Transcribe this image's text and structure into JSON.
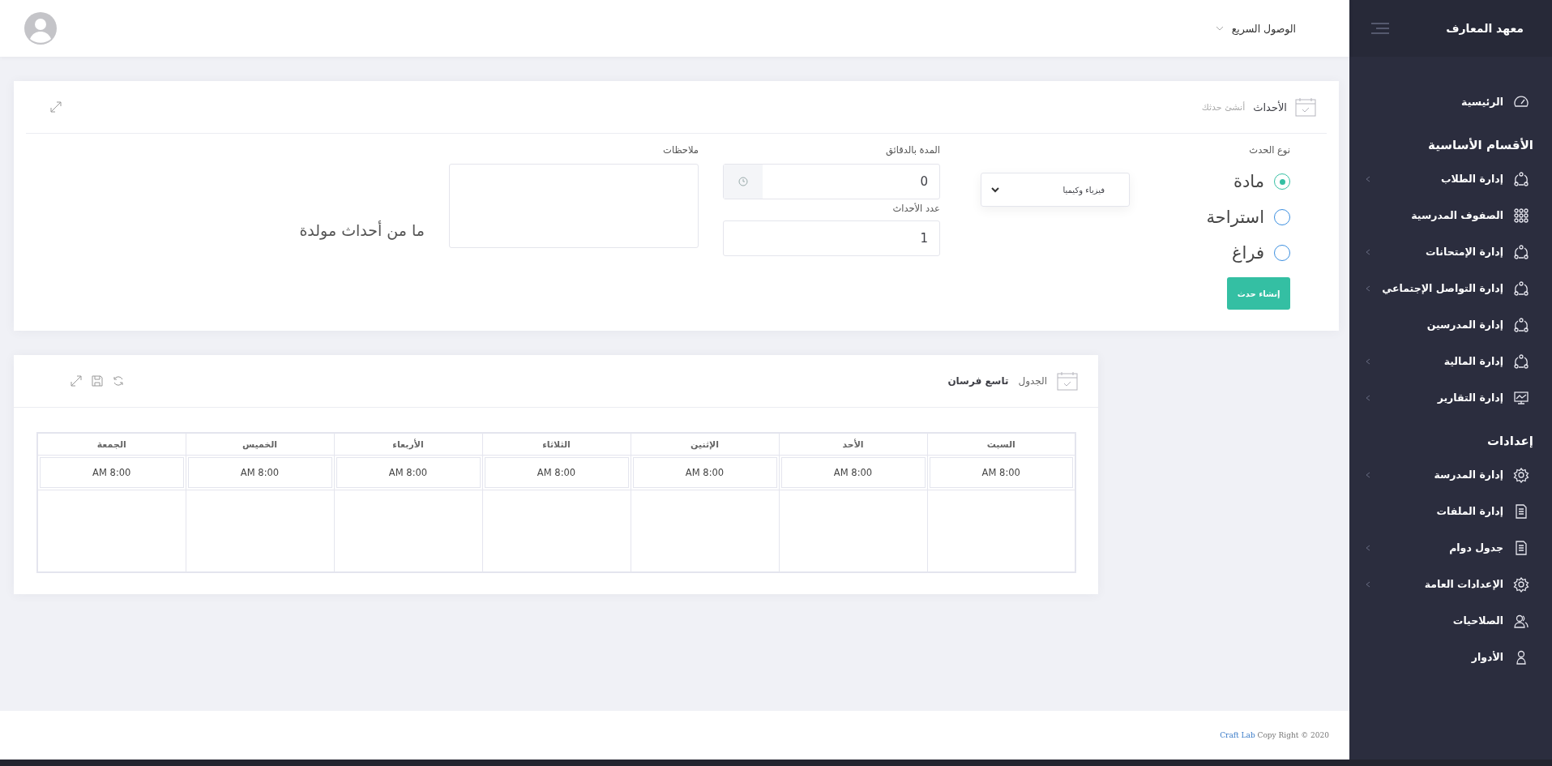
{
  "header": {
    "quick_access": "الوصول السريع"
  },
  "sidebar": {
    "title": "معهد المعارف",
    "groups": [
      {
        "items": [
          {
            "label": "الرئيسية",
            "kind": "gauge",
            "has_submenu": false
          }
        ]
      },
      {
        "heading": "الأقسام الأساسية",
        "items": [
          {
            "label": "إدارة الطلاب",
            "kind": "nodes",
            "has_submenu": true
          },
          {
            "label": "الصفوف المدرسية",
            "kind": "grid",
            "has_submenu": false
          },
          {
            "label": "إدارة الإمتحانات",
            "kind": "nodes",
            "has_submenu": true
          },
          {
            "label": "إدارة التواصل الإجتماعي",
            "kind": "nodes",
            "has_submenu": true
          },
          {
            "label": "إدارة المدرسين",
            "kind": "nodes",
            "has_submenu": false
          },
          {
            "label": "إدارة المالية",
            "kind": "nodes",
            "has_submenu": true
          },
          {
            "label": "إدارة التقارير",
            "kind": "monitor",
            "has_submenu": true
          }
        ]
      },
      {
        "heading": "إعدادات",
        "items": [
          {
            "label": "إدارة المدرسة",
            "kind": "gear",
            "has_submenu": true
          },
          {
            "label": "إدارة الملفات",
            "kind": "file",
            "has_submenu": false
          },
          {
            "label": "جدول دوام",
            "kind": "file",
            "has_submenu": true
          },
          {
            "label": "الإعدادات العامة",
            "kind": "gear",
            "has_submenu": true
          },
          {
            "label": "الصلاحيات",
            "kind": "users",
            "has_submenu": false
          },
          {
            "label": "الأدوار",
            "kind": "user",
            "has_submenu": false
          }
        ]
      }
    ]
  },
  "events": {
    "title": "الأحداث",
    "subtitle": "أنشئ حدثك",
    "type_label": "نوع الحدث",
    "types": [
      {
        "label": "مادة",
        "selected": true
      },
      {
        "label": "استراحة",
        "selected": false
      },
      {
        "label": "فراغ",
        "selected": false
      }
    ],
    "subject": "فيزياء وكيميا",
    "duration_label": "المدة بالدقائق",
    "duration": "0",
    "count_label": "عدد الأحداث",
    "count": "1",
    "notes_label": "ملاحظات",
    "create_button": "إنشاء حدث",
    "empty_message": "ما من أحداث مولدة"
  },
  "schedule": {
    "title": "الجدول",
    "class_name": "تاسع فرسان",
    "columns": [
      "السبت",
      "الأحد",
      "الإثنين",
      "الثلاثاء",
      "الأربعاء",
      "الخميس",
      "الجمعة"
    ],
    "times": [
      "8:00 AM",
      "8:00 AM",
      "8:00 AM",
      "8:00 AM",
      "8:00 AM",
      "8:00 AM",
      "8:00 AM"
    ]
  },
  "footer": {
    "brand": "Craft Lab",
    "text": "Copy Right © 2020"
  }
}
